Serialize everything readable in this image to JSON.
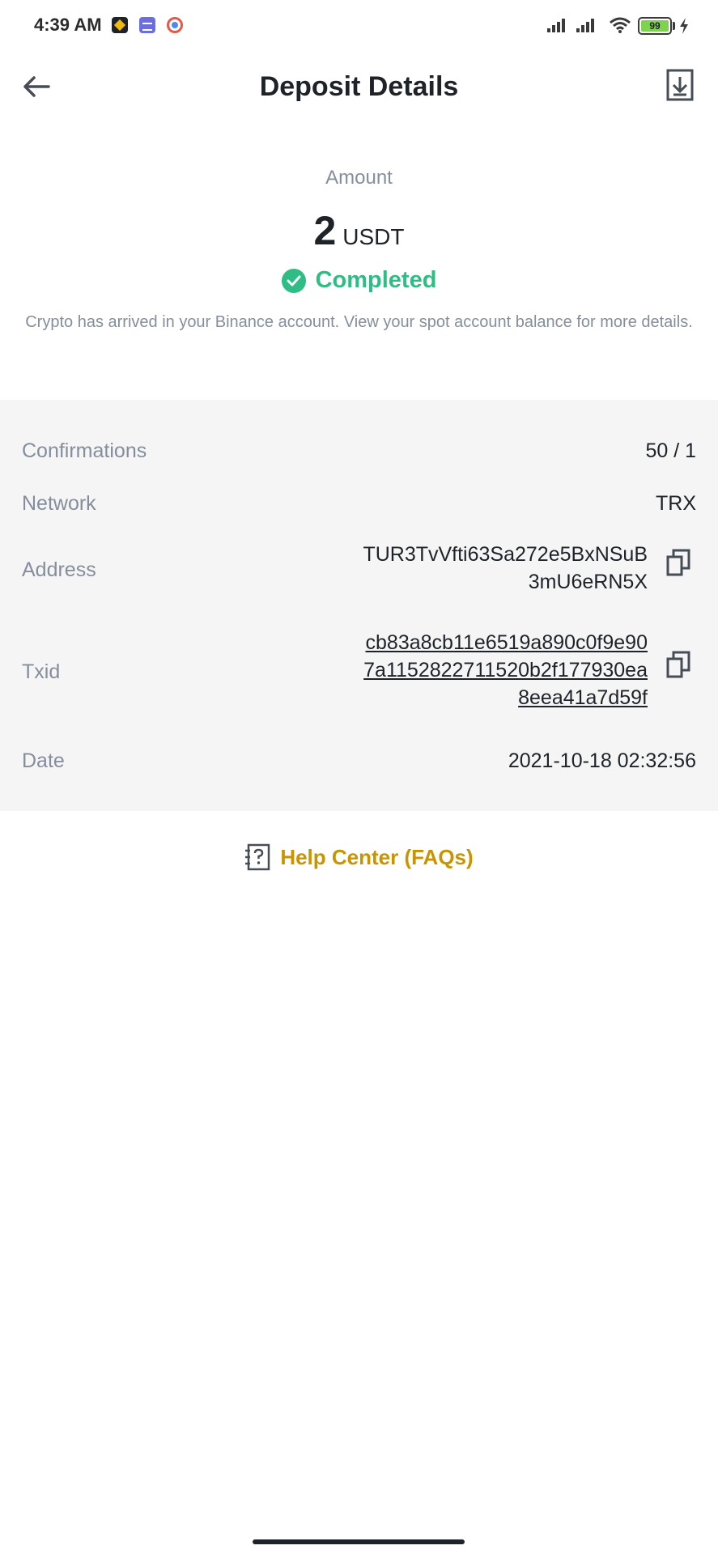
{
  "status_bar": {
    "time": "4:39 AM",
    "notification_icons": [
      "binance-icon",
      "app-icon",
      "chrome-icon"
    ],
    "battery_level": "99",
    "charging": true
  },
  "header": {
    "title": "Deposit Details",
    "back_icon": "arrow-left-icon",
    "download_icon": "download-icon"
  },
  "amount": {
    "label": "Amount",
    "value": "2",
    "unit": "USDT"
  },
  "status": {
    "icon": "check-circle-icon",
    "text": "Completed",
    "description": "Crypto has arrived in your Binance account. View your spot account balance for more details."
  },
  "details": {
    "confirmations": {
      "label": "Confirmations",
      "value": "50 / 1"
    },
    "network": {
      "label": "Network",
      "value": "TRX"
    },
    "address": {
      "label": "Address",
      "line1": "TUR3TvVfti63Sa272e5BxNSuB",
      "line2": "3mU6eRN5X"
    },
    "txid": {
      "label": "Txid",
      "line1": "cb83a8cb11e6519a890c0f9e90",
      "line2": "7a1152822711520b2f177930ea",
      "line3": "8eea41a7d59f"
    },
    "date": {
      "label": "Date",
      "value": "2021-10-18 02:32:56"
    }
  },
  "help": {
    "icon": "help-document-icon",
    "label": "Help Center (FAQs)"
  },
  "colors": {
    "success": "#2ebd85",
    "accent": "#c99400",
    "muted": "#848e9c",
    "panel": "#f5f5f5"
  }
}
